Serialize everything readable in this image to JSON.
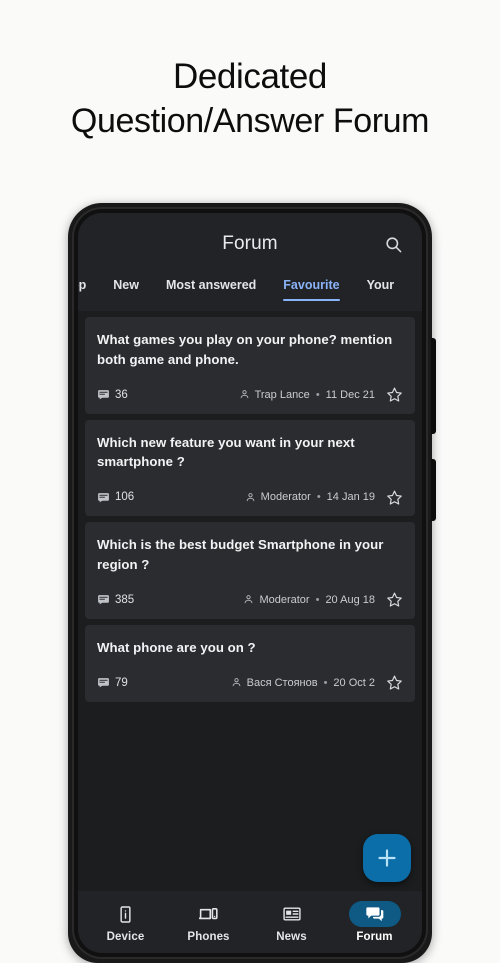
{
  "promo": {
    "headline_line1": "Dedicated",
    "headline_line2": "Question/Answer Forum"
  },
  "app": {
    "title": "Forum",
    "search_icon": "search-icon",
    "accent_color": "#8ab4f8",
    "fab_color": "#0b6ea8",
    "screen_bg": "#1b1d1f",
    "card_bg": "#2a2c2f"
  },
  "tabs": [
    {
      "label": "op",
      "active": false
    },
    {
      "label": "New",
      "active": false
    },
    {
      "label": "Most answered",
      "active": false
    },
    {
      "label": "Favourite",
      "active": true
    },
    {
      "label": "Your",
      "active": false
    }
  ],
  "posts": [
    {
      "title": "What games you play on your phone? mention both game and phone.",
      "comments": "36",
      "author": "Trap Lance",
      "separator": "•",
      "date": "11 Dec 21",
      "starred": false
    },
    {
      "title": "Which new feature you want in your next smartphone ?",
      "comments": "106",
      "author": "Moderator",
      "separator": "•",
      "date": "14 Jan 19",
      "starred": false
    },
    {
      "title": "Which is the best budget Smartphone in your region ?",
      "comments": "385",
      "author": "Moderator",
      "separator": "•",
      "date": "20 Aug 18",
      "starred": false
    },
    {
      "title": "What phone are you on ?",
      "comments": "79",
      "author": "Вася Стоянов",
      "separator": "•",
      "date": "20 Oct 2",
      "starred": false
    }
  ],
  "fab": {
    "label": "+",
    "icon": "plus-icon"
  },
  "bottom_nav": [
    {
      "label": "Device",
      "icon": "phone-info-icon",
      "active": false
    },
    {
      "label": "Phones",
      "icon": "devices-icon",
      "active": false
    },
    {
      "label": "News",
      "icon": "newspaper-icon",
      "active": false
    },
    {
      "label": "Forum",
      "icon": "chat-bubbles-icon",
      "active": true
    }
  ]
}
